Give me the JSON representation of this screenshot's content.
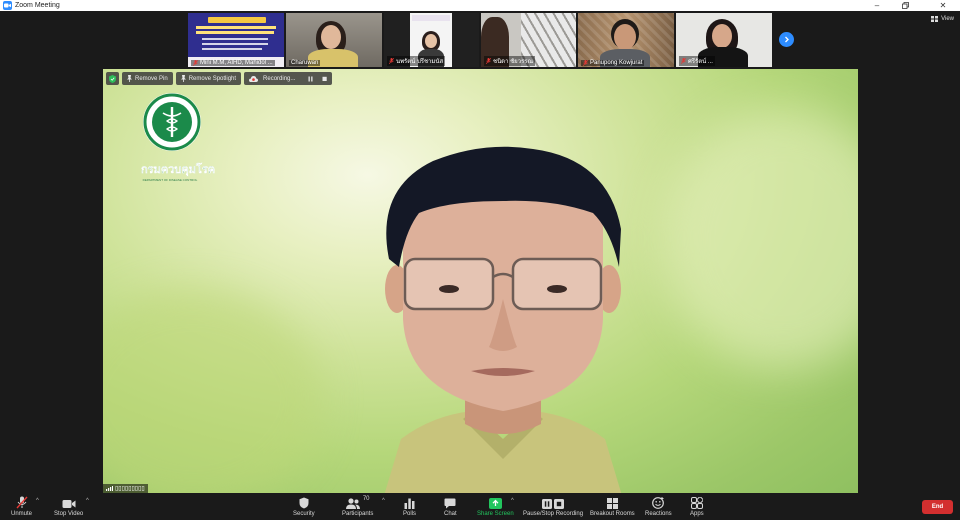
{
  "window": {
    "title": "Zoom Meeting"
  },
  "view_button": {
    "label": "View"
  },
  "participants_strip": [
    {
      "name": "Mini M.M, AIHD, Mahidol ..."
    },
    {
      "name": "Charuwan"
    },
    {
      "name": "นพรัตน์ ปรีชามนัส"
    },
    {
      "name": "ชนิดา ชัยวรรณ"
    },
    {
      "name": "Panupong Kowjurat"
    },
    {
      "name": "ศรีรัตน์ ..."
    }
  ],
  "main_video": {
    "logo_text": "กรมควบคุมโรค",
    "logo_subtext": "DEPARTMENT OF DISEASE CONTROL",
    "name_label": "▯▯▯▯▯▯▯▯▯"
  },
  "video_controls": {
    "remove_pin": "Remove Pin",
    "remove_spotlight": "Remove Spotlight",
    "recording": "Recording..."
  },
  "toolbar": {
    "unmute": "Unmute",
    "stop_video": "Stop Video",
    "security": "Security",
    "participants": "Participants",
    "participants_count": "70",
    "polls": "Polls",
    "chat": "Chat",
    "share_screen": "Share Screen",
    "pause_stop_recording": "Pause/Stop Recording",
    "breakout_rooms": "Breakout Rooms",
    "reactions": "Reactions",
    "apps": "Apps",
    "end": "End"
  },
  "colors": {
    "accent": "#2d8cff",
    "end": "#d32f2f",
    "share": "#22c55e",
    "muted": "#e53935"
  }
}
